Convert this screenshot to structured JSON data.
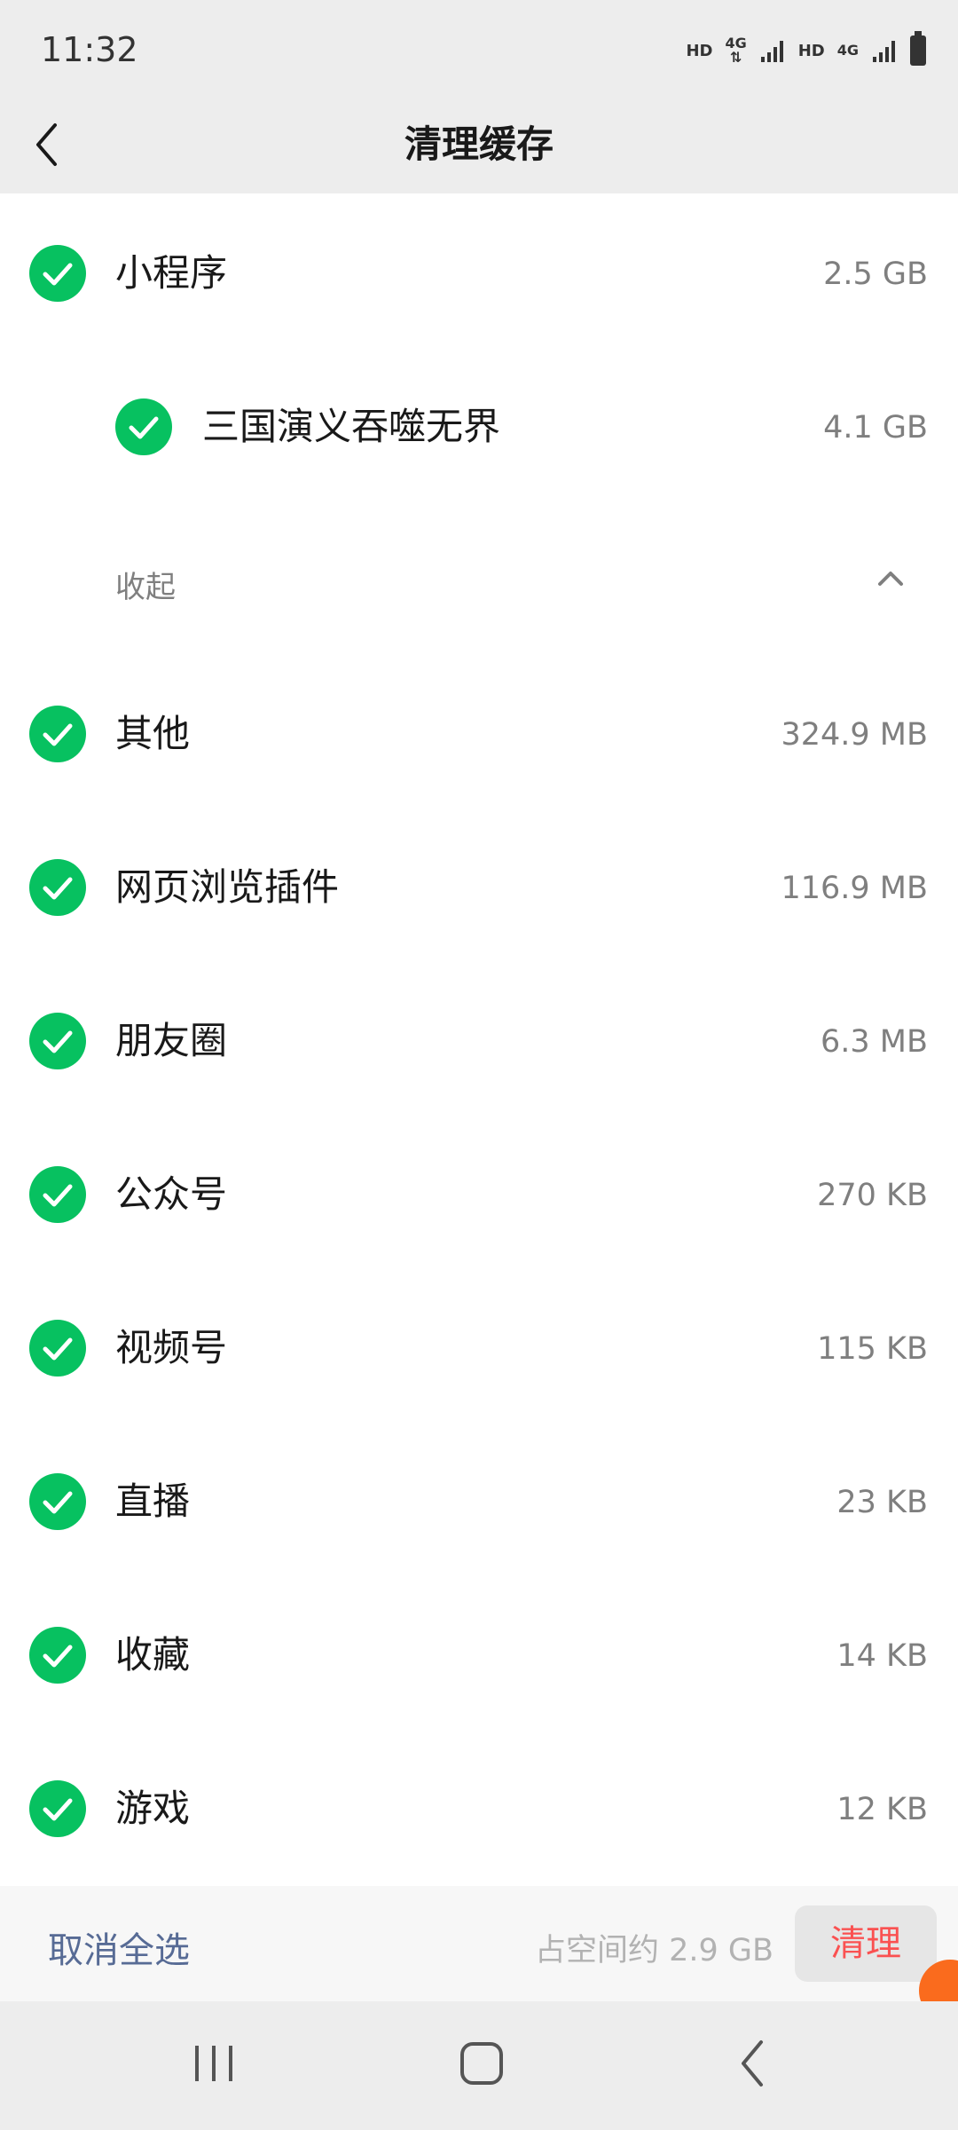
{
  "status_bar": {
    "time": "11:32",
    "indicators": [
      "HD",
      "4G",
      "HD",
      "4G"
    ],
    "icons": [
      "signal-icon",
      "signal-icon",
      "battery-icon"
    ]
  },
  "navbar": {
    "back_icon": "chevron-left-icon",
    "title": "清理缓存"
  },
  "items": [
    {
      "label": "小程序",
      "size": "2.5 GB",
      "checked": true
    },
    {
      "label": "三国演义吞噬无界",
      "size": "4.1 GB",
      "checked": true,
      "indent": true
    },
    {
      "label": "其他",
      "size": "324.9 MB",
      "checked": true
    },
    {
      "label": "网页浏览插件",
      "size": "116.9 MB",
      "checked": true
    },
    {
      "label": "朋友圈",
      "size": "6.3 MB",
      "checked": true
    },
    {
      "label": "公众号",
      "size": "270 KB",
      "checked": true
    },
    {
      "label": "视频号",
      "size": "115 KB",
      "checked": true
    },
    {
      "label": "直播",
      "size": "23 KB",
      "checked": true
    },
    {
      "label": "收藏",
      "size": "14 KB",
      "checked": true
    },
    {
      "label": "游戏",
      "size": "12 KB",
      "checked": true
    }
  ],
  "collapse": {
    "label": "收起",
    "icon": "chevron-up-icon"
  },
  "bottom_bar": {
    "deselect_label": "取消全选",
    "space_info": "占空间约 2.9 GB",
    "clear_label": "清理"
  },
  "colors": {
    "check_green": "#07c160",
    "link_blue": "#576b95",
    "danger_red": "#fa5151",
    "header_bg": "#ededed"
  }
}
